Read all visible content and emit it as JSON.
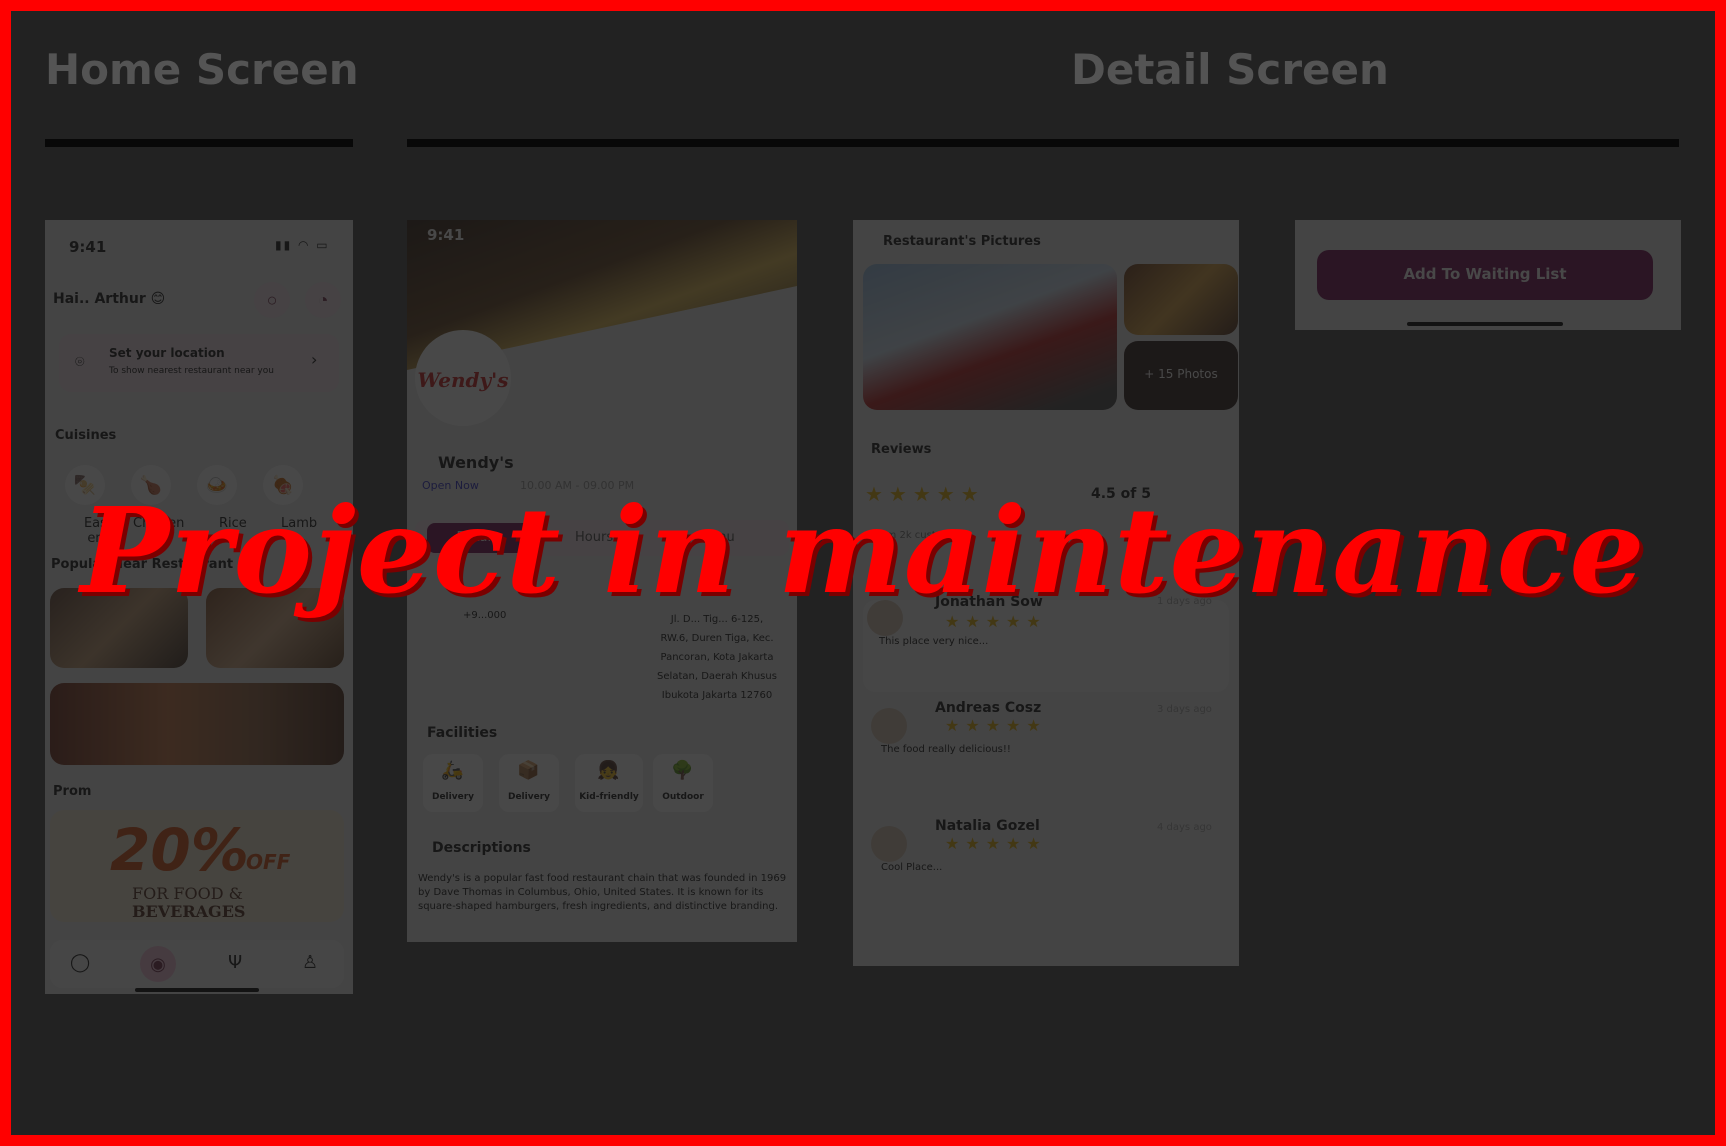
{
  "sections": {
    "home_title": "Home Screen",
    "detail_title": "Detail Screen"
  },
  "home": {
    "time": "9:41",
    "greeting": "Hai.. Arthur 😊",
    "location_title": "Set your location",
    "location_sub": "To show nearest restaurant near you",
    "cuisines_title": "Cuisines",
    "cuisines": [
      "East ern",
      "Chicken",
      "Rice",
      "Lamb"
    ],
    "popular_title": "Popular Near Restaurant",
    "promo_title": "Prom",
    "promo_pct": "20%",
    "promo_off": "OFF",
    "promo_line1": "FOR FOOD &",
    "promo_line2": "BEVERAGES"
  },
  "detail": {
    "time": "9:41",
    "logo_text": "Wendy's",
    "name": "Wendy's",
    "status": "Open Now",
    "hours": "10.00 AM - 09.00 PM",
    "tabs": [
      "Details",
      "Hours",
      "Menu"
    ],
    "phone": "+9...000",
    "address": [
      "Jl. D... Tig... 6-125,",
      "RW.6, Duren Tiga, Kec.",
      "Pancoran, Kota Jakarta",
      "Selatan, Daerah Khusus",
      "Ibukota Jakarta 12760"
    ],
    "facilities_title": "Facilities",
    "facilities": [
      "Delivery",
      "Delivery",
      "Kid-friendly",
      "Outdoor"
    ],
    "descriptions_title": "Descriptions",
    "description": "Wendy's is a popular fast food restaurant chain that was founded in 1969 by Dave Thomas in Columbus, Ohio, United States. It is known for its square-shaped hamburgers, fresh ingredients, and distinctive branding."
  },
  "detail2": {
    "pictures_title": "Restaurant's Pictures",
    "more_photos": "+ 15 Photos",
    "reviews_title": "Reviews",
    "rating": "4.5 of 5",
    "from_customers": "from 2k customers",
    "reviews": [
      {
        "name": "Jonathan Sow",
        "when": "1 days ago",
        "text": "This place very nice..."
      },
      {
        "name": "Andreas Cosz",
        "when": "3 days ago",
        "text": "The food really delicious!!"
      },
      {
        "name": "Natalia Gozel",
        "when": "4 days ago",
        "text": "Cool Place..."
      }
    ]
  },
  "waiting": {
    "button": "Add To Waiting List"
  },
  "overlay": {
    "message": "Project in maintenance"
  },
  "colors": {
    "border": "#ff0000",
    "accent": "#7a1a5a",
    "star": "#e7b416"
  }
}
